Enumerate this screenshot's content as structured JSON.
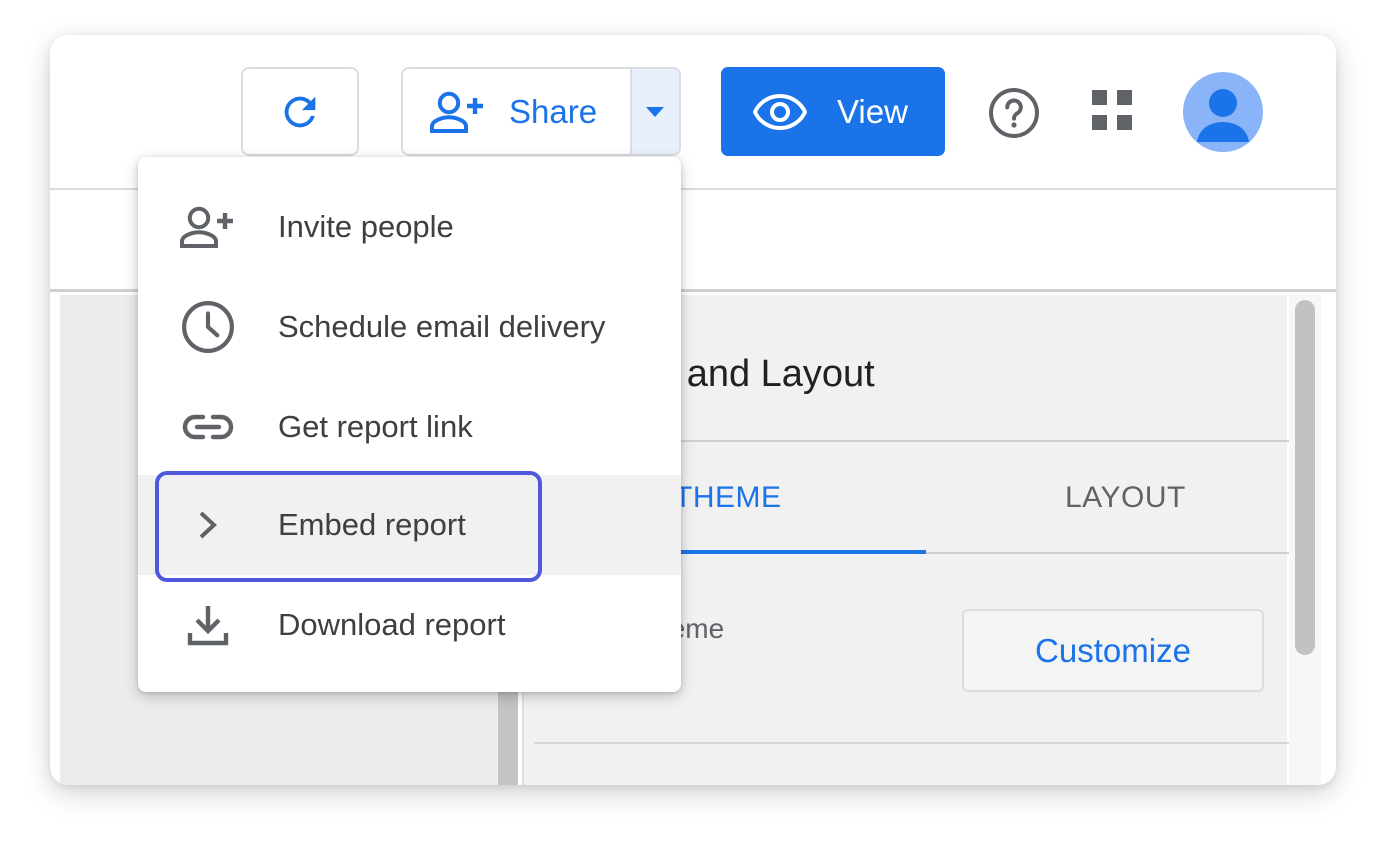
{
  "toolbar": {
    "refresh_icon": "refresh-icon",
    "share_label": "Share",
    "share_icon": "person-add-icon",
    "view_label": "View",
    "view_icon": "eye-icon",
    "help_icon": "help-icon",
    "apps_icon": "apps-grid-icon",
    "avatar_icon": "account-avatar"
  },
  "panel": {
    "title": "e and Layout",
    "tabs": [
      {
        "label": "THEME",
        "active": true
      },
      {
        "label": "LAYOUT",
        "active": false
      }
    ],
    "theme_label": "t Theme",
    "customize_label": "Customize"
  },
  "menu": {
    "items": [
      {
        "label": "Invite people",
        "icon": "person-add-icon"
      },
      {
        "label": "Schedule email delivery",
        "icon": "clock-icon"
      },
      {
        "label": "Get report link",
        "icon": "link-icon"
      },
      {
        "label": "Embed report",
        "icon": "chevron-right-icon",
        "highlighted": true
      },
      {
        "label": "Download report",
        "icon": "download-icon"
      }
    ]
  },
  "colors": {
    "accent": "#1a73e8",
    "focus_ring": "#5058dd",
    "avatar_bg": "#8ab4f8"
  }
}
